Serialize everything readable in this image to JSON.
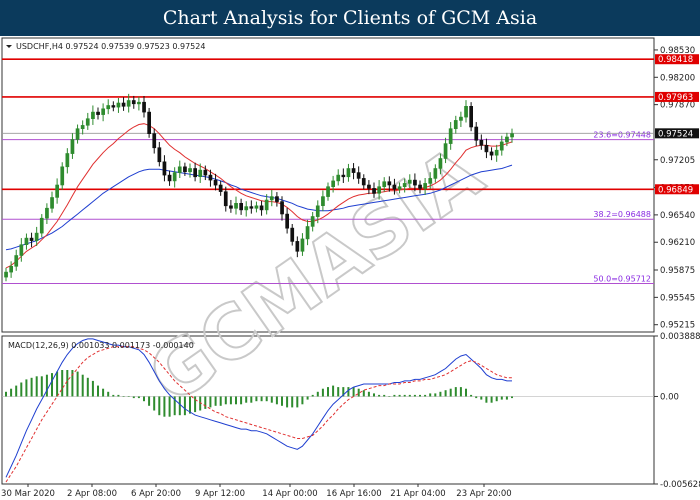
{
  "banner": {
    "title": "Chart Analysis for Clients of GCM Asia"
  },
  "watermark": "GCMASIA",
  "chart_data": {
    "type": "candlestick",
    "symbol_line": "USDCHF,H4  0.97524 0.97539 0.97523 0.97524",
    "price_axis": {
      "ylim": [
        0.95127,
        0.98674
      ],
      "ticks": [
        "0.98530",
        "0.98200",
        "0.97870",
        "0.97205",
        "0.96870",
        "0.96540",
        "0.96210",
        "0.95875",
        "0.95545",
        "0.95215"
      ]
    },
    "time_labels": [
      "30 Mar 2020",
      "2 Apr 08:00",
      "6 Apr 20:00",
      "9 Apr 12:00",
      "14 Apr 00:00",
      "16 Apr 16:00",
      "21 Apr 04:00",
      "23 Apr 20:00"
    ],
    "resistance_support": [
      {
        "label": "0.98418",
        "value": 0.98418
      },
      {
        "label": "0.97963",
        "value": 0.97963
      },
      {
        "label": "0.96849",
        "value": 0.96849
      }
    ],
    "fibonacci": [
      {
        "label": "23.6=0.97448",
        "value": 0.97448
      },
      {
        "label": "38.2=0.96488",
        "value": 0.96488
      },
      {
        "label": "50.0=0.95712",
        "value": 0.95712
      }
    ],
    "last_price": "0.97524",
    "closes": [
      0.9585,
      0.9592,
      0.9605,
      0.9618,
      0.9626,
      0.9623,
      0.9632,
      0.965,
      0.9662,
      0.9675,
      0.969,
      0.9712,
      0.9728,
      0.9745,
      0.9758,
      0.9762,
      0.977,
      0.9778,
      0.9775,
      0.9782,
      0.9786,
      0.9784,
      0.9789,
      0.9785,
      0.9792,
      0.9788,
      0.979,
      0.9778,
      0.9752,
      0.9735,
      0.9718,
      0.9702,
      0.9695,
      0.9705,
      0.9712,
      0.9706,
      0.971,
      0.97,
      0.9708,
      0.9702,
      0.9696,
      0.969,
      0.9682,
      0.9665,
      0.9662,
      0.9668,
      0.966,
      0.9664,
      0.9662,
      0.9665,
      0.966,
      0.9672,
      0.9676,
      0.967,
      0.9655,
      0.9638,
      0.9622,
      0.961,
      0.9625,
      0.964,
      0.9652,
      0.9665,
      0.9676,
      0.9688,
      0.9695,
      0.9702,
      0.97,
      0.971,
      0.9705,
      0.9698,
      0.969,
      0.9686,
      0.968,
      0.9688,
      0.9694,
      0.969,
      0.9685,
      0.9688,
      0.9692,
      0.9696,
      0.969,
      0.9686,
      0.9692,
      0.9698,
      0.971,
      0.9722,
      0.974,
      0.9758,
      0.9768,
      0.9772,
      0.9785,
      0.976,
      0.9744,
      0.9738,
      0.973,
      0.9726,
      0.9732,
      0.9742,
      0.9748,
      0.9752
    ],
    "ma_red": [
      0.959,
      0.9593,
      0.9598,
      0.9604,
      0.961,
      0.9614,
      0.9618,
      0.9624,
      0.963,
      0.9638,
      0.9646,
      0.9656,
      0.9666,
      0.9677,
      0.9688,
      0.9697,
      0.9706,
      0.9715,
      0.9722,
      0.9729,
      0.9735,
      0.974,
      0.9746,
      0.9751,
      0.9756,
      0.976,
      0.9763,
      0.9764,
      0.9762,
      0.9758,
      0.9752,
      0.9745,
      0.9738,
      0.9733,
      0.9729,
      0.9724,
      0.972,
      0.9716,
      0.9713,
      0.971,
      0.9706,
      0.9702,
      0.9698,
      0.9693,
      0.9688,
      0.9684,
      0.968,
      0.9677,
      0.9675,
      0.9673,
      0.9671,
      0.967,
      0.967,
      0.9669,
      0.9667,
      0.9663,
      0.9658,
      0.9652,
      0.9648,
      0.9646,
      0.9646,
      0.9648,
      0.9651,
      0.9655,
      0.966,
      0.9665,
      0.9669,
      0.9673,
      0.9676,
      0.9678,
      0.9679,
      0.968,
      0.968,
      0.9681,
      0.9682,
      0.9683,
      0.9683,
      0.9684,
      0.9685,
      0.9686,
      0.9686,
      0.9686,
      0.9687,
      0.9689,
      0.9692,
      0.9696,
      0.9702,
      0.9709,
      0.9717,
      0.9724,
      0.9732,
      0.9735,
      0.9737,
      0.9738,
      0.9738,
      0.9737,
      0.9737,
      0.9738,
      0.974,
      0.9742
    ],
    "ma_blue": [
      0.9612,
      0.9613,
      0.9615,
      0.9617,
      0.9619,
      0.9621,
      0.9623,
      0.9626,
      0.9629,
      0.9632,
      0.9636,
      0.964,
      0.9645,
      0.965,
      0.9655,
      0.966,
      0.9665,
      0.967,
      0.9675,
      0.968,
      0.9684,
      0.9688,
      0.9692,
      0.9696,
      0.97,
      0.9703,
      0.9706,
      0.9708,
      0.9709,
      0.9709,
      0.9709,
      0.9708,
      0.9707,
      0.9706,
      0.9705,
      0.9704,
      0.9703,
      0.9702,
      0.9701,
      0.97,
      0.9699,
      0.9697,
      0.9695,
      0.9693,
      0.969,
      0.9688,
      0.9685,
      0.9683,
      0.9681,
      0.9679,
      0.9677,
      0.9676,
      0.9675,
      0.9674,
      0.9672,
      0.967,
      0.9668,
      0.9665,
      0.9663,
      0.9661,
      0.966,
      0.9659,
      0.9659,
      0.9659,
      0.966,
      0.9661,
      0.9662,
      0.9664,
      0.9665,
      0.9666,
      0.9667,
      0.9668,
      0.9669,
      0.967,
      0.9671,
      0.9672,
      0.9673,
      0.9674,
      0.9675,
      0.9676,
      0.9677,
      0.9678,
      0.9679,
      0.968,
      0.9682,
      0.9684,
      0.9687,
      0.969,
      0.9693,
      0.9696,
      0.9699,
      0.9702,
      0.9704,
      0.9706,
      0.9707,
      0.9708,
      0.9709,
      0.971,
      0.9712,
      0.9714
    ],
    "macd": {
      "label": "MACD(12,26,9)  0.001033 0.001173 -0.000140",
      "ylim": [
        -0.005628,
        0.003888
      ],
      "ticks": [
        "0.003888",
        "0.00",
        "-0.005628"
      ],
      "macd_line": [
        -0.0052,
        -0.0045,
        -0.0038,
        -0.003,
        -0.0022,
        -0.0015,
        -0.0008,
        -0.0002,
        0.0004,
        0.001,
        0.0016,
        0.0022,
        0.0027,
        0.0031,
        0.0034,
        0.0036,
        0.0037,
        0.0037,
        0.0036,
        0.0035,
        0.0034,
        0.0033,
        0.0033,
        0.0032,
        0.0032,
        0.0031,
        0.003,
        0.0027,
        0.0022,
        0.0016,
        0.001,
        0.0005,
        0.0001,
        -0.0002,
        -0.0005,
        -0.0008,
        -0.001,
        -0.0012,
        -0.0013,
        -0.0014,
        -0.0015,
        -0.0016,
        -0.0017,
        -0.0018,
        -0.0019,
        -0.002,
        -0.0021,
        -0.0021,
        -0.0022,
        -0.0022,
        -0.0023,
        -0.0024,
        -0.0026,
        -0.0028,
        -0.003,
        -0.0032,
        -0.0033,
        -0.0034,
        -0.0032,
        -0.0028,
        -0.0024,
        -0.0019,
        -0.0014,
        -0.0009,
        -0.0005,
        -0.0002,
        0.0001,
        0.0004,
        0.0006,
        0.0007,
        0.0008,
        0.0008,
        0.0008,
        0.0008,
        0.0008,
        0.0008,
        0.0009,
        0.0009,
        0.001,
        0.001,
        0.0011,
        0.0011,
        0.0012,
        0.0013,
        0.0014,
        0.0016,
        0.0018,
        0.0021,
        0.0024,
        0.0026,
        0.0027,
        0.0024,
        0.0021,
        0.0018,
        0.0014,
        0.0012,
        0.0011,
        0.0011,
        0.001,
        0.001
      ],
      "signal_line": [
        -0.0055,
        -0.005,
        -0.0045,
        -0.0039,
        -0.0033,
        -0.0027,
        -0.0021,
        -0.0015,
        -0.001,
        -0.0005,
        0.0,
        0.0005,
        0.001,
        0.0014,
        0.0018,
        0.0022,
        0.0025,
        0.0027,
        0.0029,
        0.003,
        0.0031,
        0.0032,
        0.0032,
        0.0032,
        0.0032,
        0.0032,
        0.0031,
        0.003,
        0.0028,
        0.0025,
        0.0022,
        0.0018,
        0.0014,
        0.001,
        0.0007,
        0.0004,
        0.0001,
        -0.0002,
        -0.0004,
        -0.0006,
        -0.0008,
        -0.001,
        -0.0011,
        -0.0013,
        -0.0014,
        -0.0015,
        -0.0016,
        -0.0017,
        -0.0018,
        -0.0019,
        -0.002,
        -0.0021,
        -0.0022,
        -0.0023,
        -0.0024,
        -0.0025,
        -0.0026,
        -0.0027,
        -0.0027,
        -0.0026,
        -0.0025,
        -0.0022,
        -0.0019,
        -0.0015,
        -0.0012,
        -0.0008,
        -0.0005,
        -0.0002,
        0.0,
        0.0002,
        0.0004,
        0.0005,
        0.0006,
        0.0007,
        0.0007,
        0.0008,
        0.0008,
        0.0008,
        0.0009,
        0.0009,
        0.001,
        0.001,
        0.0011,
        0.0011,
        0.0012,
        0.0013,
        0.0014,
        0.0016,
        0.0018,
        0.002,
        0.0022,
        0.0023,
        0.0022,
        0.002,
        0.0018,
        0.0016,
        0.0014,
        0.0013,
        0.0012,
        0.0012
      ],
      "histogram": [
        0.0003,
        0.0005,
        0.0007,
        0.0009,
        0.0011,
        0.0012,
        0.0013,
        0.0013,
        0.0014,
        0.0015,
        0.0016,
        0.0017,
        0.0017,
        0.0017,
        0.0016,
        0.0014,
        0.0012,
        0.001,
        0.0007,
        0.0005,
        0.0003,
        0.0001,
        0.0001,
        0.0,
        0.0,
        -0.0001,
        -0.0001,
        -0.0003,
        -0.0006,
        -0.0009,
        -0.0012,
        -0.0013,
        -0.0013,
        -0.0012,
        -0.0012,
        -0.0012,
        -0.0011,
        -0.001,
        -0.0009,
        -0.0008,
        -0.0007,
        -0.0006,
        -0.0006,
        -0.0005,
        -0.0005,
        -0.0005,
        -0.0005,
        -0.0004,
        -0.0004,
        -0.0003,
        -0.0003,
        -0.0003,
        -0.0004,
        -0.0005,
        -0.0006,
        -0.0007,
        -0.0007,
        -0.0007,
        -0.0005,
        -0.0002,
        0.0001,
        0.0003,
        0.0005,
        0.0006,
        0.0007,
        0.0006,
        0.0006,
        0.0006,
        0.0006,
        0.0005,
        0.0004,
        0.0003,
        0.0002,
        0.0001,
        0.0001,
        0.0,
        0.0001,
        0.0001,
        0.0001,
        0.0001,
        0.0001,
        0.0001,
        0.0001,
        0.0002,
        0.0002,
        0.0003,
        0.0004,
        0.0005,
        0.0006,
        0.0006,
        0.0005,
        0.0001,
        -0.0001,
        -0.0002,
        -0.0004,
        -0.0004,
        -0.0003,
        -0.0002,
        -0.0002,
        -0.0001
      ]
    },
    "colors": {
      "resistance": "#e00000",
      "fibonacci": "#b050d0",
      "ma_red": "#e03030",
      "ma_blue": "#1f3fd0",
      "candle_up": "#2e8b2e",
      "candle_down": "#111111",
      "macd_line": "#1f3fd0",
      "signal_line": "#e03030",
      "histogram": "#2e8b2e",
      "banner": "#0b3a5c"
    }
  }
}
